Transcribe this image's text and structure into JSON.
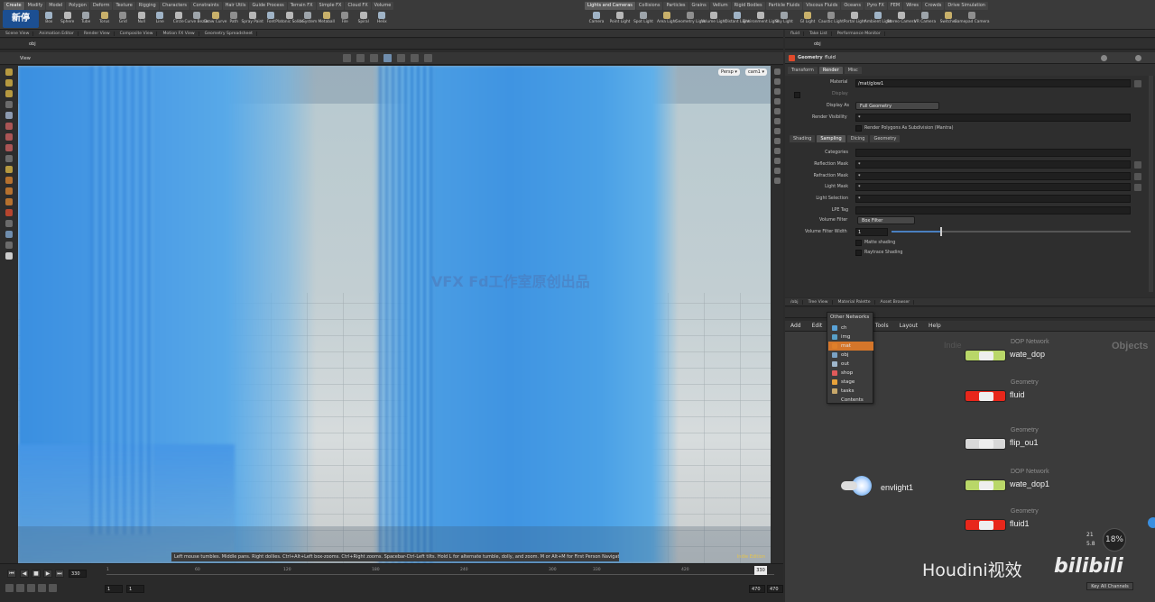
{
  "shelf_tabs_left": [
    "Create",
    "Modify",
    "Model",
    "Polygon",
    "Deform",
    "Texture",
    "Rigging",
    "Characters",
    "Constraints",
    "Hair Utils",
    "Guide Process",
    "Terrain FX",
    "Simple FX",
    "Cloud FX",
    "Volume"
  ],
  "shelf_tabs_right": [
    "Lights and Cameras",
    "Collisions",
    "Particles",
    "Grains",
    "Vellum",
    "Rigid Bodies",
    "Particle Fluids",
    "Viscous Fluids",
    "Oceans",
    "Pyro FX",
    "FEM",
    "Wires",
    "Crowds",
    "Drive Simulation"
  ],
  "tools_left": [
    "Box",
    "Sphere",
    "Tube",
    "Torus",
    "Grid",
    "Null",
    "Line",
    "Circle",
    "Curve Bezier",
    "Draw Curve",
    "Path",
    "Spray Paint",
    "Font",
    "Platonic Solids",
    "L-System",
    "Metaball",
    "File",
    "Spiral",
    "Helix"
  ],
  "tools_right": [
    "Camera",
    "Point Light",
    "Spot Light",
    "Area Light",
    "Geometry Light",
    "Volume Light",
    "Distant Light",
    "Environment Light",
    "Sky Light",
    "GI Light",
    "Caustic Light",
    "Portal Light",
    "Ambient Light",
    "Stereo Camera",
    "VR Camera",
    "Switcher",
    "Gamepad Camera"
  ],
  "left_pane_tabs": [
    "Scene View",
    "Animation Editor",
    "Render View",
    "Composite View",
    "Motion FX View",
    "Geometry Spreadsheet"
  ],
  "right_pane_tabs": [
    "fluid",
    "Take List",
    "Performance Monitor"
  ],
  "network_pane_tabs": [
    "/obj",
    "Tree View",
    "Material Palette",
    "Asset Browser"
  ],
  "left_path": "obj",
  "right_path": "obj",
  "viewport": {
    "title": "View",
    "camera_menu": "Persp ▾",
    "cam_menu": "cam1 ▾",
    "hint": "Left mouse tumbles. Middle pans. Right dollies. Ctrl+Alt+Left box-zooms. Ctrl+Right zooms. Spacebar-Ctrl-Left tilts. Hold L for alternate tumble, dolly, and zoom.    M or Alt+M for First Person Navigation.",
    "edition": "Indie Edition",
    "watermark": "VFX Fd工作室原创出品",
    "colors": {
      "fluid": "#3d8fd6",
      "fluid_light": "#7fc4ef",
      "sky": "#bccbd0"
    }
  },
  "params": {
    "node_type": "Geometry",
    "node_name": "fluid",
    "tabs": [
      "Transform",
      "Render",
      "Misc"
    ],
    "active_tab": "Render",
    "material_label": "Material",
    "material_value": "/mat/glow1",
    "display_label": "Display",
    "display_as_label": "Display As",
    "display_as_value": "Full Geometry",
    "render_vis_label": "Render Visibility",
    "render_vis_value": "*",
    "subdiv_label": "Render Polygons As Subdivision (Mantra)",
    "subtabs": [
      "Shading",
      "Sampling",
      "Dicing",
      "Geometry"
    ],
    "active_subtab": "Sampling",
    "rows": [
      {
        "label": "Categories",
        "value": ""
      },
      {
        "label": "Reflection Mask",
        "value": "*"
      },
      {
        "label": "Refraction Mask",
        "value": "*"
      },
      {
        "label": "Light Mask",
        "value": "*"
      },
      {
        "label": "Light Selection",
        "value": "*"
      },
      {
        "label": "LPE Tag",
        "value": ""
      }
    ],
    "volume_filter_label": "Volume Filter",
    "volume_filter_value": "Box Filter",
    "volume_filter_width_label": "Volume Filter Width",
    "volume_filter_width_value": "1",
    "matte_label": "Matte shading",
    "raytrace_label": "Raytrace Shading"
  },
  "network": {
    "menu_bar": [
      "Add",
      "Edit",
      "Go",
      "View",
      "Tools",
      "Layout",
      "Help"
    ],
    "context_label": "Objects",
    "faded_label": "Indie",
    "nodes": [
      {
        "type": "DOP Network",
        "name": "wate_dop",
        "color": "#b9d768"
      },
      {
        "type": "Geometry",
        "name": "fluid",
        "color": "#e8271b"
      },
      {
        "type": "Geometry",
        "name": "flip_ou1",
        "color": "#d8d8d8"
      },
      {
        "type": "DOP Network",
        "name": "wate_dop1",
        "color": "#b9d768"
      },
      {
        "type": "Geometry",
        "name": "fluid1",
        "color": "#e8271b"
      }
    ],
    "light_name": "envlight1",
    "other_networks_title": "Other Networks",
    "other_networks": [
      {
        "label": "ch",
        "color": "#5aa3d8"
      },
      {
        "label": "img",
        "color": "#58a0c8"
      },
      {
        "label": "mat",
        "color": "#e07f2a"
      },
      {
        "label": "obj",
        "color": "#7aa2c4"
      },
      {
        "label": "out",
        "color": "#9fb7cc"
      },
      {
        "label": "shop",
        "color": "#e05a5a"
      },
      {
        "label": "stage",
        "color": "#e8a23a"
      },
      {
        "label": "tasks",
        "color": "#c8a86a"
      },
      {
        "label": "Contents",
        "color": "#3c3c3c"
      }
    ],
    "selected_index": 2
  },
  "timeline": {
    "frame": "330",
    "start": "1",
    "start2": "1",
    "end": "470",
    "end2": "470",
    "ticks": [
      "1",
      "",
      "60",
      "",
      "120",
      "",
      "180",
      "",
      "240",
      "",
      "300",
      "330",
      "",
      "420",
      ""
    ],
    "key_all": "Key All Channels",
    "current_marker": "330"
  },
  "overlay": {
    "brand": "Houdini视效",
    "site": "bilibili",
    "percent": "18%",
    "stat1": "21",
    "stat2": "5.8"
  }
}
